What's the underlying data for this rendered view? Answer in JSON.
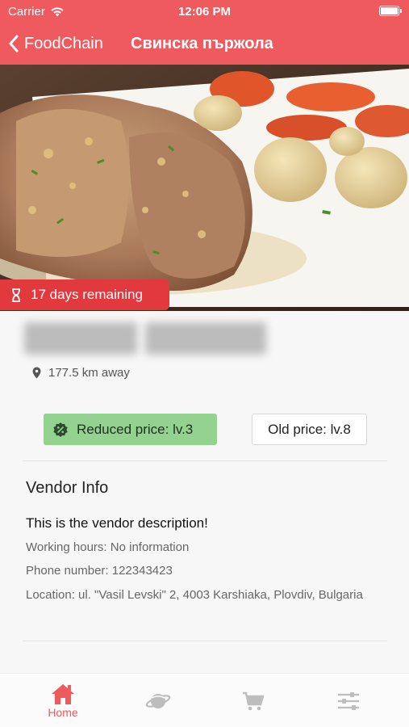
{
  "status_bar": {
    "carrier": "Carrier",
    "time": "12:06 PM",
    "battery_level": 1.0
  },
  "nav": {
    "back_label": "FoodChain",
    "title": "Свинска пържола"
  },
  "product": {
    "days_remaining": "17 days remaining",
    "distance": "177.5 km away",
    "reduced_price": "Reduced price: lv.3",
    "old_price": "Old price: lv.8"
  },
  "vendor": {
    "heading": "Vendor Info",
    "description": "This is the vendor description!",
    "working_hours": "Working hours: No information",
    "phone": "Phone number: 122343423",
    "location": "Location: ul. \"Vasil Levski\" 2, 4003 Karshiaka, Plovdiv, Bulgaria"
  },
  "tabbar": {
    "home_label": "Home",
    "active_tab": "home",
    "tabs": [
      {
        "id": "home",
        "icon": "home-icon"
      },
      {
        "id": "explore",
        "icon": "planet-icon"
      },
      {
        "id": "cart",
        "icon": "cart-icon"
      },
      {
        "id": "filters",
        "icon": "sliders-icon"
      }
    ]
  },
  "colors": {
    "brand": "#ee5a5e",
    "badge": "#e2393e",
    "reduced": "#93d38f",
    "inactive_icon": "#bdbdbd"
  }
}
